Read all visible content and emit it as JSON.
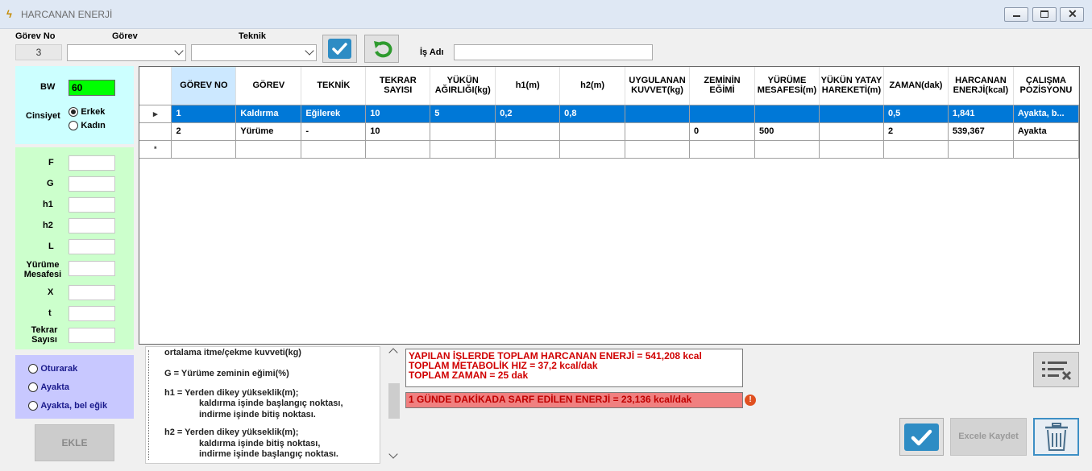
{
  "window": {
    "title": "HARCANAN ENERJİ"
  },
  "toolbar": {
    "gorev_no_label": "Görev No",
    "gorev_no_value": "3",
    "gorev_label": "Görev",
    "gorev_value": "",
    "teknik_label": "Teknik",
    "teknik_value": "",
    "is_adi_label": "İş Adı",
    "is_adi_value": ""
  },
  "left_panel": {
    "bw_label": "BW",
    "bw_value": "60",
    "cinsiyet_label": "Cinsiyet",
    "gender_options": [
      "Erkek",
      "Kadın"
    ],
    "gender_selected": "Erkek",
    "params": [
      {
        "label": "F",
        "value": ""
      },
      {
        "label": "G",
        "value": ""
      },
      {
        "label": "h1",
        "value": ""
      },
      {
        "label": "h2",
        "value": ""
      },
      {
        "label": "L",
        "value": ""
      },
      {
        "label": "Yürüme Mesafesi",
        "value": ""
      },
      {
        "label": "X",
        "value": ""
      },
      {
        "label": "t",
        "value": ""
      },
      {
        "label": "Tekrar Sayısı",
        "value": ""
      }
    ],
    "posture_options": [
      "Oturarak",
      "Ayakta",
      "Ayakta, bel eğik"
    ],
    "ekle_label": "EKLE"
  },
  "grid": {
    "columns": [
      "GÖREV NO",
      "GÖREV",
      "TEKNİK",
      "TEKRAR SAYISI",
      "YÜKÜN AĞIRLIĞI(kg)",
      "h1(m)",
      "h2(m)",
      "UYGULANAN KUVVET(kg)",
      "ZEMİNİN EĞİMİ",
      "YÜRÜME MESAFESİ(m)",
      "YÜKÜN YATAY HAREKETİ(m)",
      "ZAMAN(dak)",
      "HARCANAN ENERJİ(kcal)",
      "ÇALIŞMA POZİSYONU"
    ],
    "rows": [
      [
        "1",
        "Kaldırma",
        "Eğilerek",
        "10",
        "5",
        "0,2",
        "0,8",
        "",
        "",
        "",
        "",
        "0,5",
        "1,841",
        "Ayakta, b..."
      ],
      [
        "2",
        "Yürüme",
        "-",
        "10",
        "",
        "",
        "",
        "",
        "0",
        "500",
        "",
        "2",
        "539,367",
        "Ayakta"
      ]
    ],
    "new_row_marker": "*"
  },
  "info_text": {
    "line1": "ortalama itme/çekme kuvveti(kg)",
    "line2": "G = Yürüme zeminin eğimi(%)",
    "line3": "h1 = Yerden dikey yükseklik(m);",
    "line4": "kaldırma işinde başlangıç noktası,",
    "line5": "indirme işinde bitiş noktası.",
    "line6": "h2 = Yerden dikey yükseklik(m);",
    "line7": "kaldırma işinde bitiş noktası,",
    "line8": "indirme işinde başlangıç noktası."
  },
  "results": {
    "line1": "YAPILAN İŞLERDE TOPLAM HARCANAN ENERJİ = 541,208 kcal",
    "line2": "TOPLAM METABOLİK HIZ = 37,2 kcal/dak",
    "line3": "TOPLAM ZAMAN = 25 dak",
    "daily": "1 GÜNDE DAKİKADA SARF EDİLEN ENERJİ = 23,136 kcal/dak"
  },
  "buttons": {
    "excel_label": "Excele Kaydet"
  },
  "colors": {
    "accent": "#0078d7",
    "bw_field": "#00ff00",
    "cyan_panel": "#ccffff",
    "green_panel": "#ccffcc",
    "purple_panel": "#c8c8ff",
    "error": "#d00000"
  }
}
